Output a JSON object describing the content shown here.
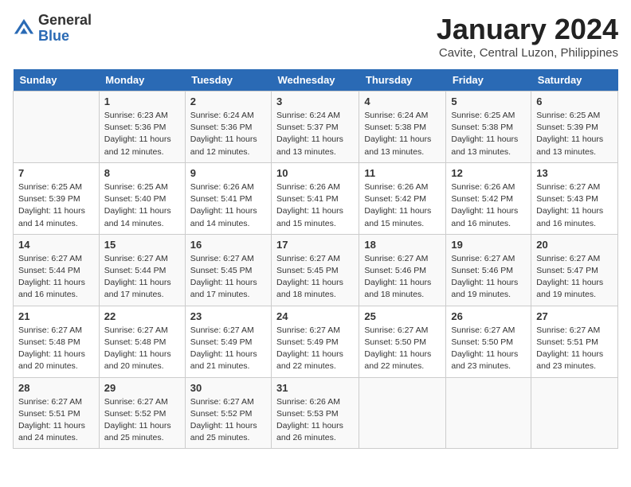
{
  "header": {
    "logo_general": "General",
    "logo_blue": "Blue",
    "title": "January 2024",
    "subtitle": "Cavite, Central Luzon, Philippines"
  },
  "days_of_week": [
    "Sunday",
    "Monday",
    "Tuesday",
    "Wednesday",
    "Thursday",
    "Friday",
    "Saturday"
  ],
  "weeks": [
    [
      {
        "day": "",
        "info": ""
      },
      {
        "day": "1",
        "info": "Sunrise: 6:23 AM\nSunset: 5:36 PM\nDaylight: 11 hours\nand 12 minutes."
      },
      {
        "day": "2",
        "info": "Sunrise: 6:24 AM\nSunset: 5:36 PM\nDaylight: 11 hours\nand 12 minutes."
      },
      {
        "day": "3",
        "info": "Sunrise: 6:24 AM\nSunset: 5:37 PM\nDaylight: 11 hours\nand 13 minutes."
      },
      {
        "day": "4",
        "info": "Sunrise: 6:24 AM\nSunset: 5:38 PM\nDaylight: 11 hours\nand 13 minutes."
      },
      {
        "day": "5",
        "info": "Sunrise: 6:25 AM\nSunset: 5:38 PM\nDaylight: 11 hours\nand 13 minutes."
      },
      {
        "day": "6",
        "info": "Sunrise: 6:25 AM\nSunset: 5:39 PM\nDaylight: 11 hours\nand 13 minutes."
      }
    ],
    [
      {
        "day": "7",
        "info": "Sunrise: 6:25 AM\nSunset: 5:39 PM\nDaylight: 11 hours\nand 14 minutes."
      },
      {
        "day": "8",
        "info": "Sunrise: 6:25 AM\nSunset: 5:40 PM\nDaylight: 11 hours\nand 14 minutes."
      },
      {
        "day": "9",
        "info": "Sunrise: 6:26 AM\nSunset: 5:41 PM\nDaylight: 11 hours\nand 14 minutes."
      },
      {
        "day": "10",
        "info": "Sunrise: 6:26 AM\nSunset: 5:41 PM\nDaylight: 11 hours\nand 15 minutes."
      },
      {
        "day": "11",
        "info": "Sunrise: 6:26 AM\nSunset: 5:42 PM\nDaylight: 11 hours\nand 15 minutes."
      },
      {
        "day": "12",
        "info": "Sunrise: 6:26 AM\nSunset: 5:42 PM\nDaylight: 11 hours\nand 16 minutes."
      },
      {
        "day": "13",
        "info": "Sunrise: 6:27 AM\nSunset: 5:43 PM\nDaylight: 11 hours\nand 16 minutes."
      }
    ],
    [
      {
        "day": "14",
        "info": "Sunrise: 6:27 AM\nSunset: 5:44 PM\nDaylight: 11 hours\nand 16 minutes."
      },
      {
        "day": "15",
        "info": "Sunrise: 6:27 AM\nSunset: 5:44 PM\nDaylight: 11 hours\nand 17 minutes."
      },
      {
        "day": "16",
        "info": "Sunrise: 6:27 AM\nSunset: 5:45 PM\nDaylight: 11 hours\nand 17 minutes."
      },
      {
        "day": "17",
        "info": "Sunrise: 6:27 AM\nSunset: 5:45 PM\nDaylight: 11 hours\nand 18 minutes."
      },
      {
        "day": "18",
        "info": "Sunrise: 6:27 AM\nSunset: 5:46 PM\nDaylight: 11 hours\nand 18 minutes."
      },
      {
        "day": "19",
        "info": "Sunrise: 6:27 AM\nSunset: 5:46 PM\nDaylight: 11 hours\nand 19 minutes."
      },
      {
        "day": "20",
        "info": "Sunrise: 6:27 AM\nSunset: 5:47 PM\nDaylight: 11 hours\nand 19 minutes."
      }
    ],
    [
      {
        "day": "21",
        "info": "Sunrise: 6:27 AM\nSunset: 5:48 PM\nDaylight: 11 hours\nand 20 minutes."
      },
      {
        "day": "22",
        "info": "Sunrise: 6:27 AM\nSunset: 5:48 PM\nDaylight: 11 hours\nand 20 minutes."
      },
      {
        "day": "23",
        "info": "Sunrise: 6:27 AM\nSunset: 5:49 PM\nDaylight: 11 hours\nand 21 minutes."
      },
      {
        "day": "24",
        "info": "Sunrise: 6:27 AM\nSunset: 5:49 PM\nDaylight: 11 hours\nand 22 minutes."
      },
      {
        "day": "25",
        "info": "Sunrise: 6:27 AM\nSunset: 5:50 PM\nDaylight: 11 hours\nand 22 minutes."
      },
      {
        "day": "26",
        "info": "Sunrise: 6:27 AM\nSunset: 5:50 PM\nDaylight: 11 hours\nand 23 minutes."
      },
      {
        "day": "27",
        "info": "Sunrise: 6:27 AM\nSunset: 5:51 PM\nDaylight: 11 hours\nand 23 minutes."
      }
    ],
    [
      {
        "day": "28",
        "info": "Sunrise: 6:27 AM\nSunset: 5:51 PM\nDaylight: 11 hours\nand 24 minutes."
      },
      {
        "day": "29",
        "info": "Sunrise: 6:27 AM\nSunset: 5:52 PM\nDaylight: 11 hours\nand 25 minutes."
      },
      {
        "day": "30",
        "info": "Sunrise: 6:27 AM\nSunset: 5:52 PM\nDaylight: 11 hours\nand 25 minutes."
      },
      {
        "day": "31",
        "info": "Sunrise: 6:26 AM\nSunset: 5:53 PM\nDaylight: 11 hours\nand 26 minutes."
      },
      {
        "day": "",
        "info": ""
      },
      {
        "day": "",
        "info": ""
      },
      {
        "day": "",
        "info": ""
      }
    ]
  ]
}
